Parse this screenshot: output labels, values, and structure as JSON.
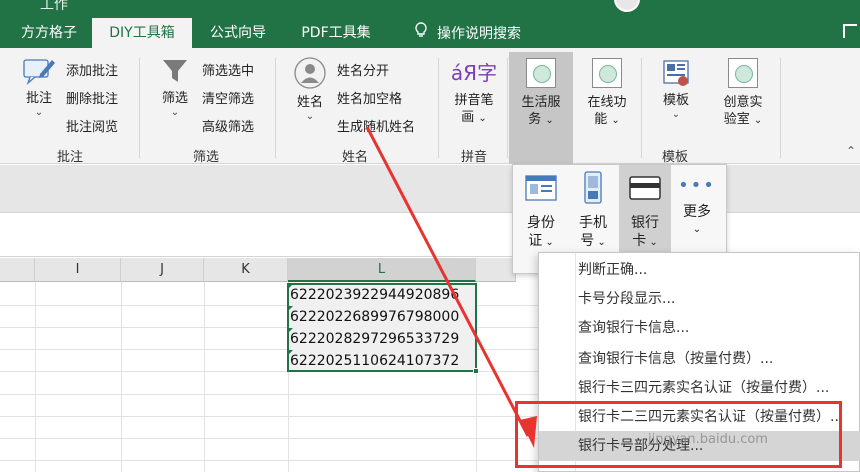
{
  "window": {
    "title_partial": "工作"
  },
  "tabs": [
    {
      "label": "方方格子",
      "active": false
    },
    {
      "label": "DIY工具箱",
      "active": true
    },
    {
      "label": "公式向导",
      "active": false
    },
    {
      "label": "PDF工具集",
      "active": false
    },
    {
      "label": "操作说明搜索",
      "active": false,
      "icon": "lightbulb-icon"
    }
  ],
  "ribbon": {
    "groups": {
      "annotation": {
        "label": "批注",
        "big_button": "批注",
        "items": [
          "添加批注",
          "删除批注",
          "批注阅览"
        ]
      },
      "filter": {
        "label": "筛选",
        "big_button": "筛选",
        "items": [
          "筛选选中",
          "清空筛选",
          "高级筛选"
        ]
      },
      "name": {
        "label": "姓名",
        "big_button": "姓名",
        "items": [
          "姓名分开",
          "姓名加空格",
          "生成随机姓名"
        ]
      },
      "pinyin": {
        "label": "拼音",
        "big_button_line1": "拼音笔",
        "big_button_line2": "画",
        "glyph": "áЯ字"
      },
      "life": {
        "line1": "生活服",
        "line2": "务"
      },
      "online": {
        "line1": "在线功",
        "line2": "能"
      },
      "template": {
        "label": "模板",
        "big_button": "模板"
      },
      "creative": {
        "line1": "创意实",
        "line2": "验室"
      }
    }
  },
  "subpanel": {
    "buttons": [
      {
        "line1": "身份",
        "line2": "证"
      },
      {
        "line1": "手机",
        "line2": "号"
      },
      {
        "line1": "银行",
        "line2": "卡"
      },
      {
        "line1": "更多",
        "line2": "",
        "dots": "•••"
      }
    ]
  },
  "grid": {
    "columns": [
      "I",
      "J",
      "K",
      "L"
    ],
    "selected_column": "L",
    "cells": [
      "6222023922944920896",
      "6222022689976798000",
      "6222028297296533729",
      "6222025110624107372"
    ]
  },
  "menu": {
    "items": [
      "判断正确...",
      "卡号分段显示...",
      "查询银行卡信息...",
      "查询银行卡信息（按量付费）...",
      "银行卡三四元素实名认证（按量付费）...",
      "银行卡二三四元素实名认证（按量付费）...",
      "银行卡号部分处理..."
    ],
    "highlighted_index": 6
  },
  "watermark": "jingyan.baidu.com",
  "colors": {
    "excel_green": "#217346",
    "annotation_red": "#e8332f"
  }
}
